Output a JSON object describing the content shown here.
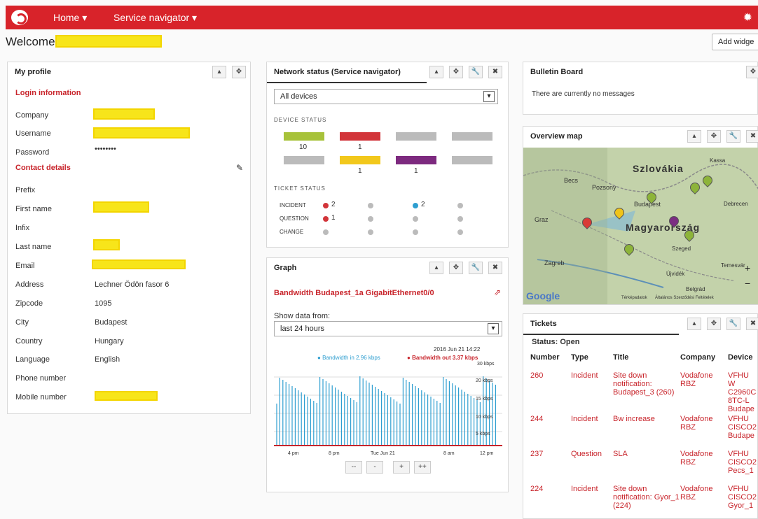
{
  "nav": {
    "home": "Home",
    "service_navigator": "Service navigator",
    "gear_icon": "gear-icon"
  },
  "welcome": "Welcome",
  "add_widget": "Add widge",
  "profile": {
    "title": "My profile",
    "login_info": "Login information",
    "company": "Company",
    "username": "Username",
    "password": "Password",
    "password_value": "••••••••",
    "contact_details": "Contact details",
    "prefix": "Prefix",
    "first_name": "First name",
    "infix": "Infix",
    "last_name": "Last name",
    "email": "Email",
    "address": "Address",
    "address_value": "Lechner Ödön fasor 6",
    "zipcode": "Zipcode",
    "zipcode_value": "1095",
    "city": "City",
    "city_value": "Budapest",
    "country": "Country",
    "country_value": "Hungary",
    "language": "Language",
    "language_value": "English",
    "phone": "Phone number",
    "mobile": "Mobile number"
  },
  "network": {
    "title": "Network status (Service navigator)",
    "select": "All devices",
    "device_status": "DEVICE STATUS",
    "green_count": "10",
    "red_count": "1",
    "yellow_count": "1",
    "purple_count": "1",
    "ticket_status": "TICKET STATUS",
    "incident": "INCIDENT",
    "question": "QUESTION",
    "change": "CHANGE",
    "incident_red": "2",
    "incident_blue": "2",
    "question_red": "1"
  },
  "graph": {
    "title": "Graph",
    "subtitle": "Bandwidth Budapest_1a GigabitEthernet0/0",
    "show_from": "Show data from:",
    "range": "last 24 hours",
    "timestamp": "2016 Jun 21 14:22",
    "legend_in": "Bandwidth in 2.96 kbps",
    "legend_out": "Bandwidth out 3.37 kbps",
    "y_ticks": [
      "30 kbps",
      "20 kbps",
      "15 kbps",
      "10 kbps",
      "5 kbps"
    ],
    "x_ticks": [
      "4 pm",
      "8 pm",
      "Tue Jun 21",
      "8 am",
      "12 pm"
    ],
    "zoom_buttons": [
      "--",
      "-",
      "+",
      "++"
    ]
  },
  "bulletin": {
    "title": "Bulletin Board",
    "message": "There are currently no messages"
  },
  "map": {
    "title": "Overview map",
    "slovakia": "Szlovákia",
    "hungary": "Magyarország",
    "becs": "Becs",
    "pozsony": "Pozsony",
    "budapest": "Budapest",
    "graz": "Graz",
    "zagreb": "Zagreb",
    "szeged": "Szeged",
    "kassa": "Kassa",
    "debrecen": "Debrecen",
    "temesvar": "Temesvár",
    "ujvidek": "Újvidék",
    "belgrad": "Belgrád",
    "google": "Google",
    "map_data": "Térképadatok",
    "terms": "Általános Szerződési Feltételek",
    "colors": {
      "green": "#8db43a",
      "red": "#d93a36",
      "yellow": "#f0c419",
      "purple": "#7b2d82"
    }
  },
  "tickets": {
    "title": "Tickets",
    "status": "Status: Open",
    "headers": [
      "Number",
      "Type",
      "Title",
      "Company",
      "Device"
    ],
    "rows": [
      {
        "number": "260",
        "type": "Incident",
        "title": "Site down notification: Budapest_3 (260)",
        "company": "Vodafone RBZ",
        "device": "VFHU W C2960C 8TC-L Budape"
      },
      {
        "number": "244",
        "type": "Incident",
        "title": "Bw increase",
        "company": "Vodafone RBZ",
        "device": "VFHU CISCO2 Budape"
      },
      {
        "number": "237",
        "type": "Question",
        "title": "SLA",
        "company": "Vodafone RBZ",
        "device": "VFHU CISCO2 Pecs_1"
      },
      {
        "number": "224",
        "type": "Incident",
        "title": "Site down notification: Gyor_1 (224)",
        "company": "Vodafone RBZ",
        "device": "VFHU CISCO2 Gyor_1"
      }
    ]
  }
}
